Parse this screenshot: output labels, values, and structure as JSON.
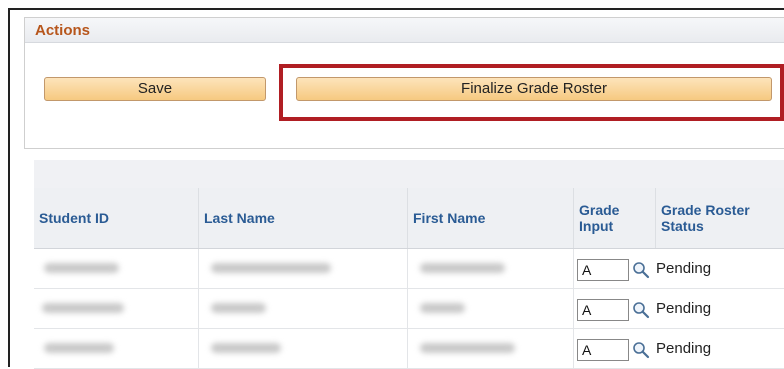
{
  "actions": {
    "title": "Actions",
    "save_label": "Save",
    "finalize_label": "Finalize Grade Roster"
  },
  "grid": {
    "columns": {
      "student_id": "Student ID",
      "last_name": "Last Name",
      "first_name": "First Name",
      "grade_input": "Grade Input",
      "grade_roster_status": "Grade Roster Status"
    },
    "rows": [
      {
        "grade": "A",
        "status": "Pending"
      },
      {
        "grade": "A",
        "status": "Pending"
      },
      {
        "grade": "A",
        "status": "Pending"
      }
    ]
  },
  "icons": {
    "lookup": "magnifier-icon"
  },
  "colors": {
    "actions_title": "#b7561c",
    "column_header": "#2a5b94",
    "button_fill": "#f6c980",
    "highlight_border": "#b01e23"
  }
}
